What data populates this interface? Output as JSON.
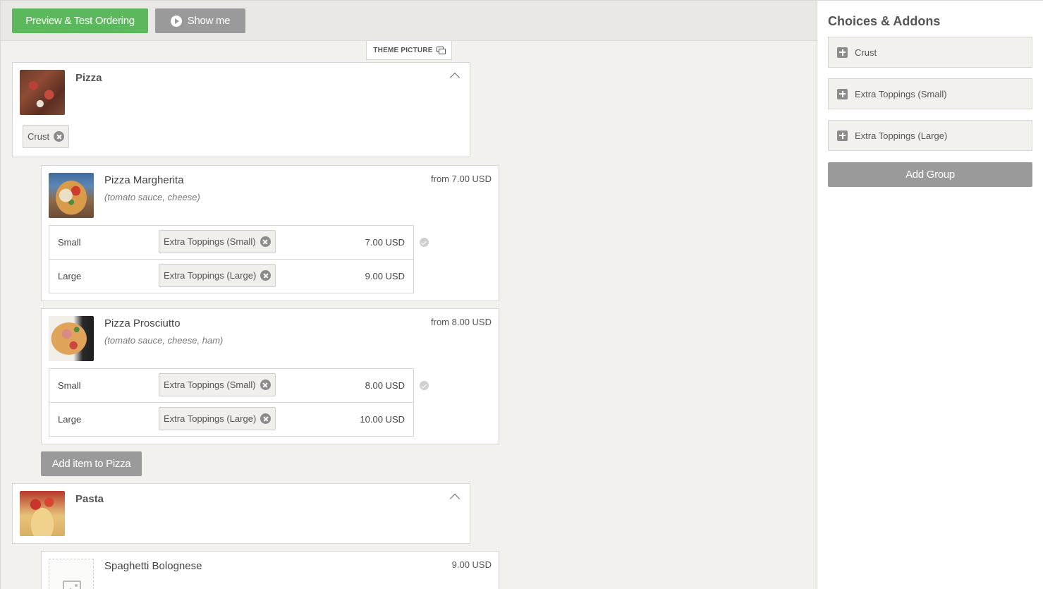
{
  "toolbar": {
    "preview_label": "Preview & Test Ordering",
    "show_me_label": "Show me"
  },
  "theme_picture_label": "THEME PICTURE",
  "categories": [
    {
      "title": "Pizza",
      "choices": [
        {
          "label": "Crust"
        }
      ],
      "items": [
        {
          "name": "Pizza Margherita",
          "description": "(tomato sauce, cheese)",
          "price": "from 7.00 USD",
          "sizes": [
            {
              "name": "Small",
              "addon": "Extra Toppings (Small)",
              "price": "7.00 USD"
            },
            {
              "name": "Large",
              "addon": "Extra Toppings (Large)",
              "price": "9.00 USD"
            }
          ]
        },
        {
          "name": "Pizza Prosciutto",
          "description": "(tomato sauce, cheese, ham)",
          "price": "from 8.00 USD",
          "sizes": [
            {
              "name": "Small",
              "addon": "Extra Toppings (Small)",
              "price": "8.00 USD"
            },
            {
              "name": "Large",
              "addon": "Extra Toppings (Large)",
              "price": "10.00 USD"
            }
          ]
        }
      ],
      "add_item_label": "Add item to Pizza"
    },
    {
      "title": "Pasta",
      "items": [
        {
          "name": "Spaghetti Bolognese",
          "price": "9.00 USD"
        }
      ]
    }
  ],
  "sidebar": {
    "title": "Choices & Addons",
    "groups": [
      {
        "label": "Crust"
      },
      {
        "label": "Extra Toppings (Small)"
      },
      {
        "label": "Extra Toppings (Large)"
      }
    ],
    "add_group_label": "Add Group"
  },
  "colors": {
    "primary_green": "#5cb85c",
    "button_gray": "#9a9a9a",
    "canvas_bg": "#f2f1ee"
  },
  "icons": [
    "play-icon",
    "copy-icon",
    "chevron-up-icon",
    "remove-icon",
    "check-icon",
    "plus-icon",
    "image-placeholder-icon"
  ]
}
